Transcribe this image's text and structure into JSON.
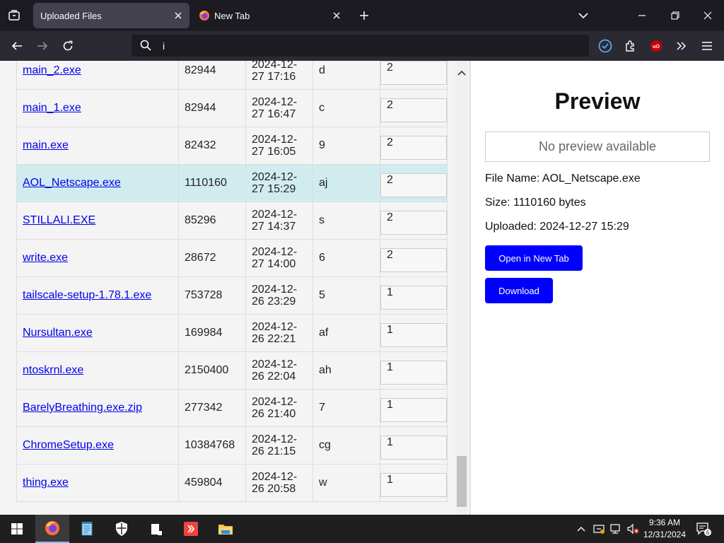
{
  "browser": {
    "tabs": [
      {
        "title": "Uploaded Files",
        "active": true
      },
      {
        "title": "New Tab",
        "active": false
      }
    ],
    "url_value": "i",
    "icons": {
      "tab_list": "tab-list-icon",
      "close_tab": "close-icon",
      "new_tab": "plus-icon",
      "list_all_tabs": "chevron-down-icon",
      "back": "back-arrow-icon",
      "forward": "forward-arrow-icon",
      "reload": "reload-icon",
      "search": "search-icon",
      "extensions": "puzzle-icon",
      "ublock": "ublock-icon",
      "overflow": "double-chevron-icon",
      "menu": "hamburger-menu-icon"
    }
  },
  "files_table": {
    "rows": [
      {
        "name": "main_2.exe",
        "size": "82944",
        "date_line1": "2024-12-",
        "date_line2": "27 17:16",
        "code": "d",
        "rating": "2",
        "selected": false
      },
      {
        "name": "main_1.exe",
        "size": "82944",
        "date_line1": "2024-12-",
        "date_line2": "27 16:47",
        "code": "c",
        "rating": "2",
        "selected": false
      },
      {
        "name": "main.exe",
        "size": "82432",
        "date_line1": "2024-12-",
        "date_line2": "27 16:05",
        "code": "9",
        "rating": "2",
        "selected": false
      },
      {
        "name": "AOL_Netscape.exe",
        "size": "1110160",
        "date_line1": "2024-12-",
        "date_line2": "27 15:29",
        "code": "aj",
        "rating": "2",
        "selected": true
      },
      {
        "name": "STILLALI.EXE",
        "size": "85296",
        "date_line1": "2024-12-",
        "date_line2": "27 14:37",
        "code": "s",
        "rating": "2",
        "selected": false
      },
      {
        "name": "write.exe",
        "size": "28672",
        "date_line1": "2024-12-",
        "date_line2": "27 14:00",
        "code": "6",
        "rating": "2",
        "selected": false
      },
      {
        "name": "tailscale-setup-1.78.1.exe",
        "size": "753728",
        "date_line1": "2024-12-",
        "date_line2": "26 23:29",
        "code": "5",
        "rating": "1",
        "selected": false
      },
      {
        "name": "Nursultan.exe",
        "size": "169984",
        "date_line1": "2024-12-",
        "date_line2": "26 22:21",
        "code": "af",
        "rating": "1",
        "selected": false
      },
      {
        "name": "ntoskrnl.exe",
        "size": "2150400",
        "date_line1": "2024-12-",
        "date_line2": "26 22:04",
        "code": "ah",
        "rating": "1",
        "selected": false
      },
      {
        "name": "BarelyBreathing.exe.zip",
        "size": "277342",
        "date_line1": "2024-12-",
        "date_line2": "26 21:40",
        "code": "7",
        "rating": "1",
        "selected": false
      },
      {
        "name": "ChromeSetup.exe",
        "size": "10384768",
        "date_line1": "2024-12-",
        "date_line2": "26 21:15",
        "code": "cg",
        "rating": "1",
        "selected": false
      },
      {
        "name": "thing.exe",
        "size": "459804",
        "date_line1": "2024-12-",
        "date_line2": "26 20:58",
        "code": "w",
        "rating": "1",
        "selected": false
      }
    ]
  },
  "preview": {
    "title": "Preview",
    "placeholder": "No preview available",
    "file_name_label": "File Name: AOL_Netscape.exe",
    "size_label": "Size: 1110160 bytes",
    "uploaded_label": "Uploaded: 2024-12-27 15:29",
    "open_button": "Open in New Tab",
    "download_button": "Download"
  },
  "taskbar": {
    "clock_time": "9:36 AM",
    "clock_date": "12/31/2024",
    "notification_count": "6",
    "colors": {
      "accent_blue": "#0000ff",
      "selected_row": "#d1ecef"
    }
  }
}
